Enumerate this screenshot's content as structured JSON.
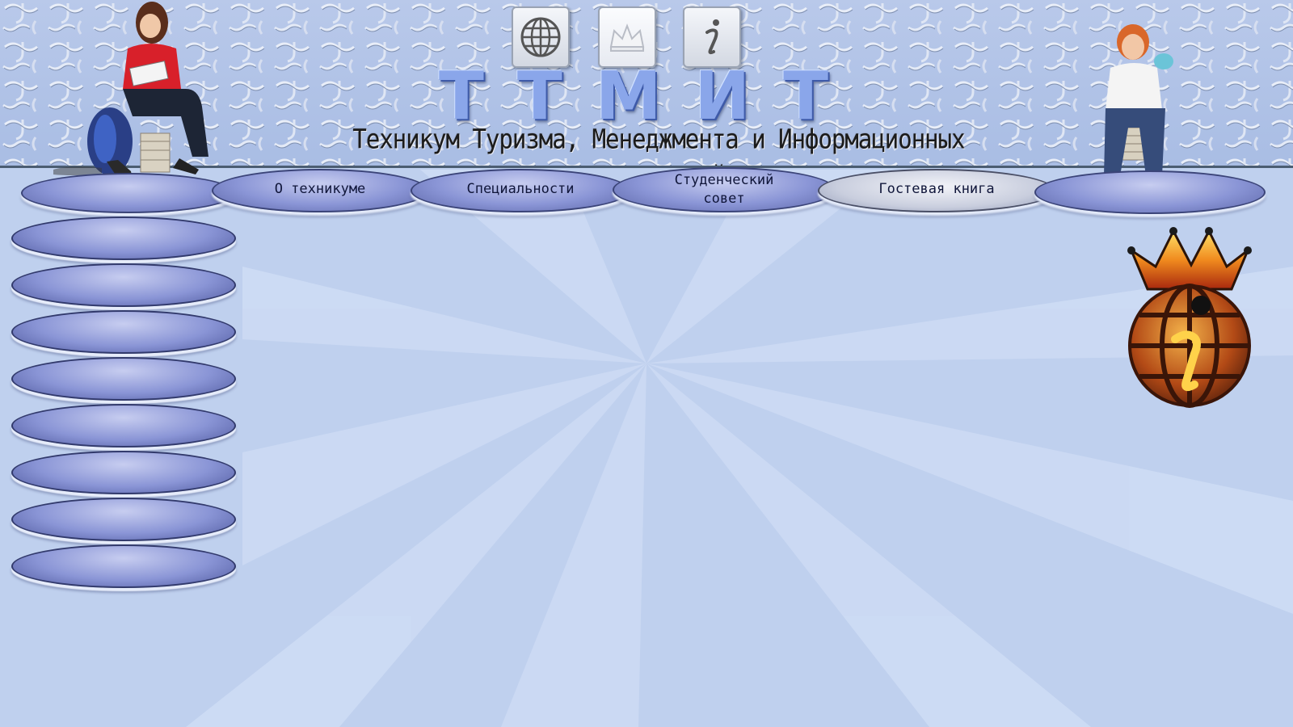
{
  "header": {
    "brand_letters": [
      "Т",
      "Т",
      "М",
      "И",
      "Т"
    ],
    "subtitle": "Техникум Туризма, Менеджмента и Информационных Технологий",
    "top_icons": [
      "globe-icon",
      "crown-icon",
      "info-icon"
    ]
  },
  "nav": {
    "items": [
      {
        "label": ""
      },
      {
        "label": "О техникуме"
      },
      {
        "label": "Специальности"
      },
      {
        "label": "Студенческий совет"
      },
      {
        "label": "Гостевая книга"
      },
      {
        "label": ""
      }
    ]
  },
  "sidebar": {
    "items": [
      {
        "label": ""
      },
      {
        "label": ""
      },
      {
        "label": ""
      },
      {
        "label": ""
      },
      {
        "label": ""
      },
      {
        "label": ""
      },
      {
        "label": ""
      },
      {
        "label": ""
      }
    ]
  },
  "emblem": {
    "icon": "crowned-globe-info-emblem-icon"
  },
  "colors": {
    "background": "#bccdec",
    "button_gradient_light": "#c7cdf0",
    "button_gradient_dark": "#5c66a8",
    "brand_letters": "#8aa6ea",
    "subtitle_text": "#1b1b1b"
  }
}
